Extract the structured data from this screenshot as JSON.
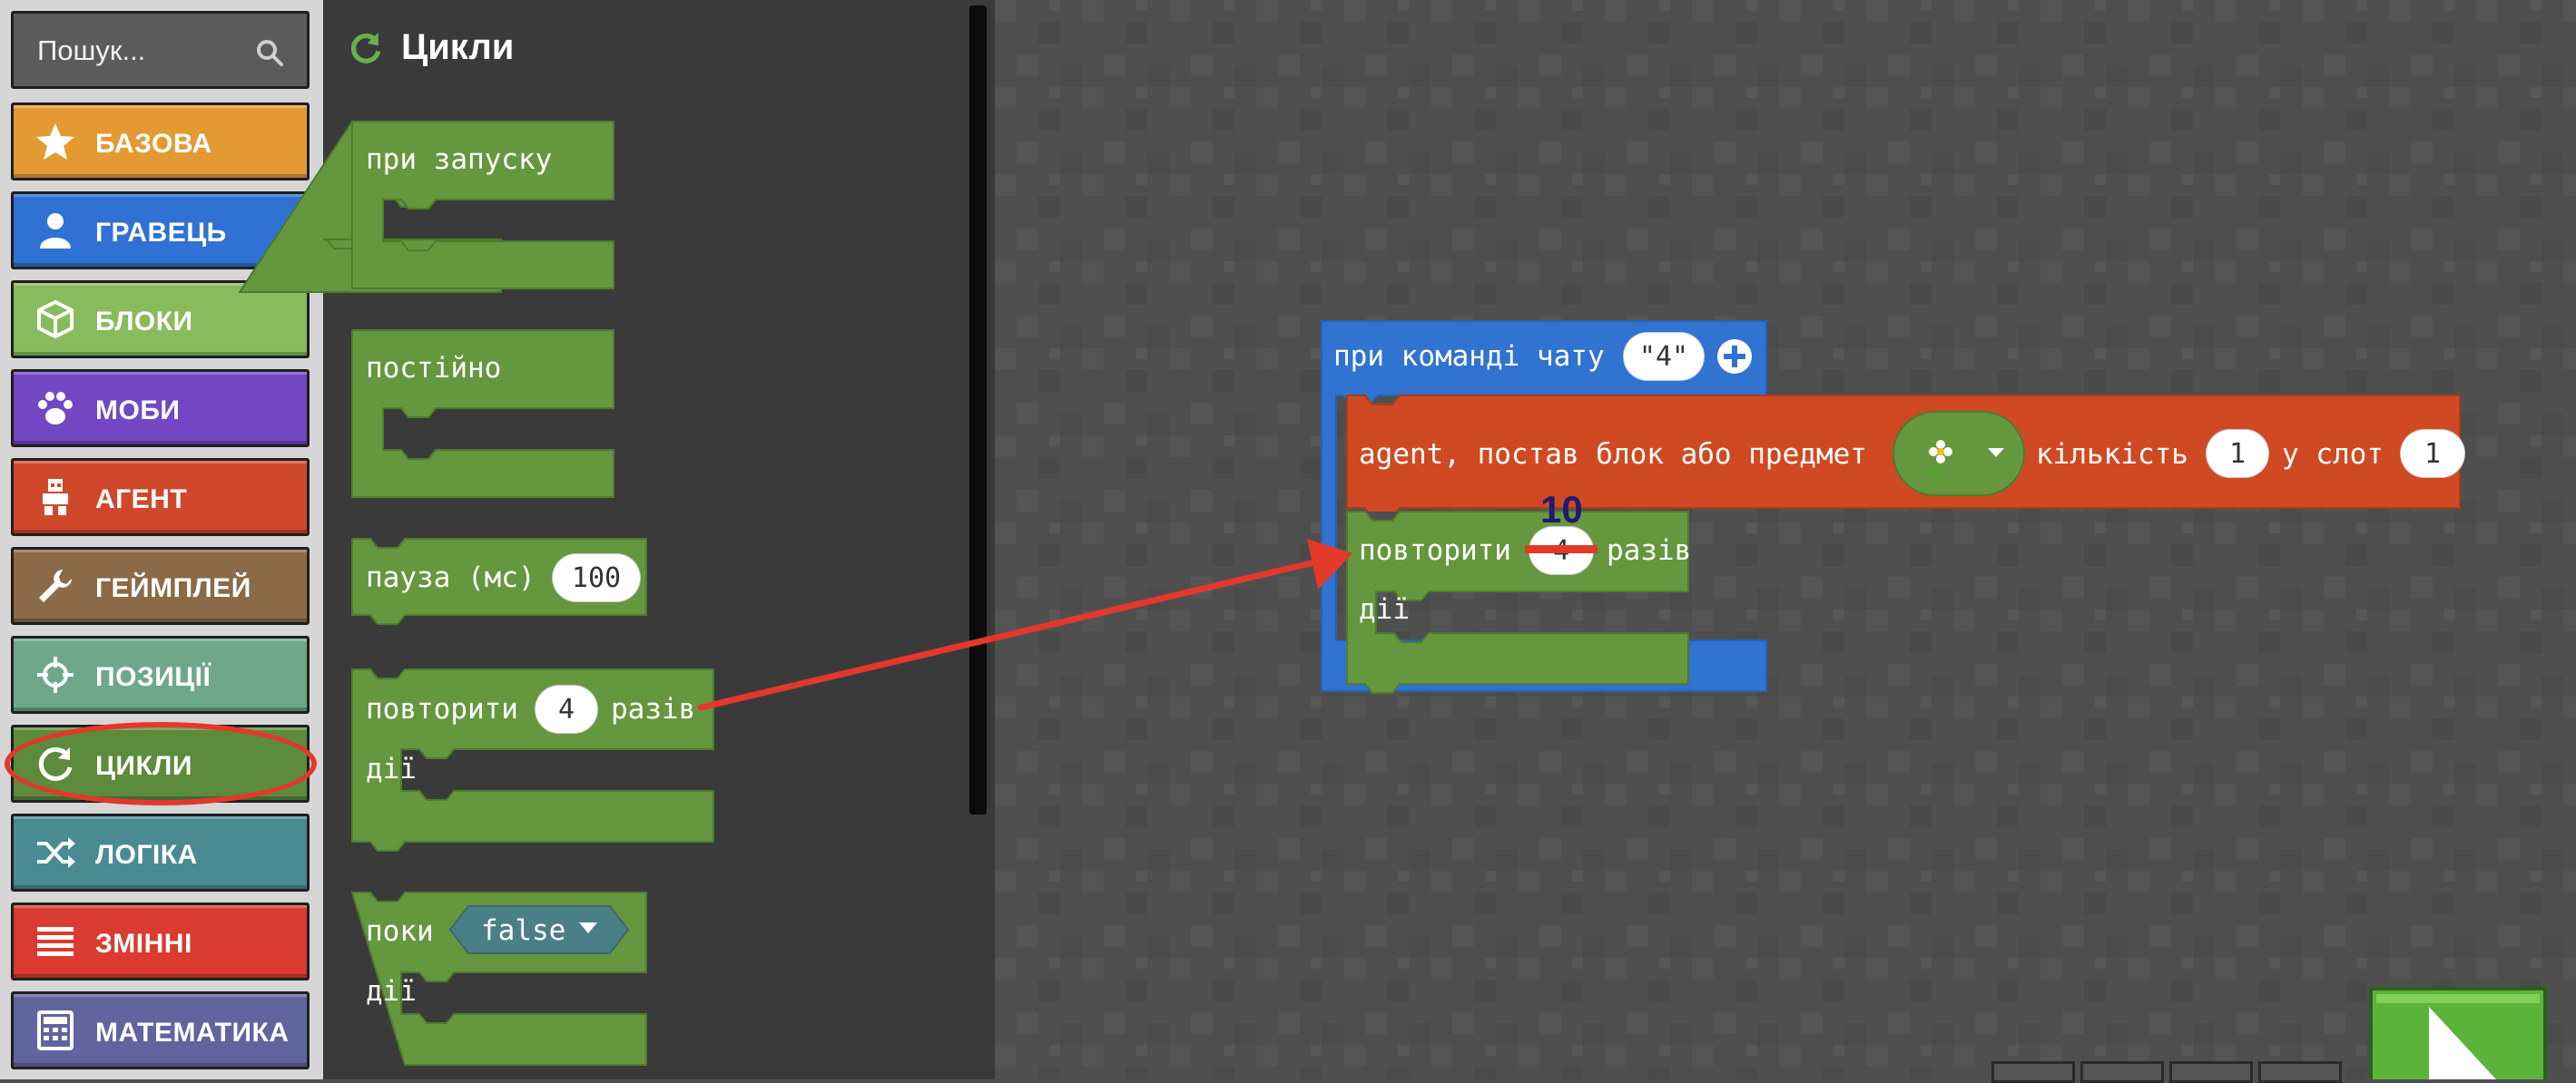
{
  "search": {
    "placeholder": "Пошук..."
  },
  "categories": [
    {
      "label": "БАЗОВА",
      "color": "#e39a33",
      "icon": "star-icon"
    },
    {
      "label": "ГРАВЕЦЬ",
      "color": "#2f72d4",
      "icon": "person-icon"
    },
    {
      "label": "БЛОКИ",
      "color": "#88bb5c",
      "icon": "cube-icon"
    },
    {
      "label": "МОБИ",
      "color": "#7347c4",
      "icon": "paw-icon"
    },
    {
      "label": "АГЕНТ",
      "color": "#d0482b",
      "icon": "agent-icon"
    },
    {
      "label": "ГЕЙМПЛЕЙ",
      "color": "#8b6a47",
      "icon": "wrench-icon"
    },
    {
      "label": "ПОЗИЦІЇ",
      "color": "#6fa889",
      "icon": "crosshair-icon"
    },
    {
      "label": "ЦИКЛИ",
      "color": "#5c8b3c",
      "icon": "refresh-icon"
    },
    {
      "label": "ЛОГІКА",
      "color": "#4a8a93",
      "icon": "shuffle-icon"
    },
    {
      "label": "ЗМІННІ",
      "color": "#d93b30",
      "icon": "list-icon"
    },
    {
      "label": "МАТЕМАТИКА",
      "color": "#60649f",
      "icon": "calculator-icon"
    }
  ],
  "flyout": {
    "title": "Цикли",
    "blocks": {
      "on_start": "при запуску",
      "forever": "постійно",
      "pause_label": "пауза (мс)",
      "pause_value": "100",
      "repeat_label": "повторити",
      "repeat_value": "4",
      "repeat_suffix": "разів",
      "do_label": "дії",
      "while_label": "поки",
      "while_value": "false",
      "while_do": "дії"
    }
  },
  "workspace": {
    "chat_block": {
      "label": "при команді чату",
      "command": "\"4\""
    },
    "agent_block": {
      "label": "agent, постав блок або предмет",
      "count_label": "кількість",
      "count_value": "1",
      "slot_label": "у слот",
      "slot_value": "1"
    },
    "repeat_block": {
      "label": "повторити",
      "value": "4",
      "suffix": "разів",
      "do_label": "дії"
    },
    "annotation_value": "10"
  },
  "colors": {
    "loops_green": "#5c8b3c",
    "events_blue": "#3073d1",
    "agent_orange": "#cf4a23",
    "annotation_red": "#e2392b"
  }
}
